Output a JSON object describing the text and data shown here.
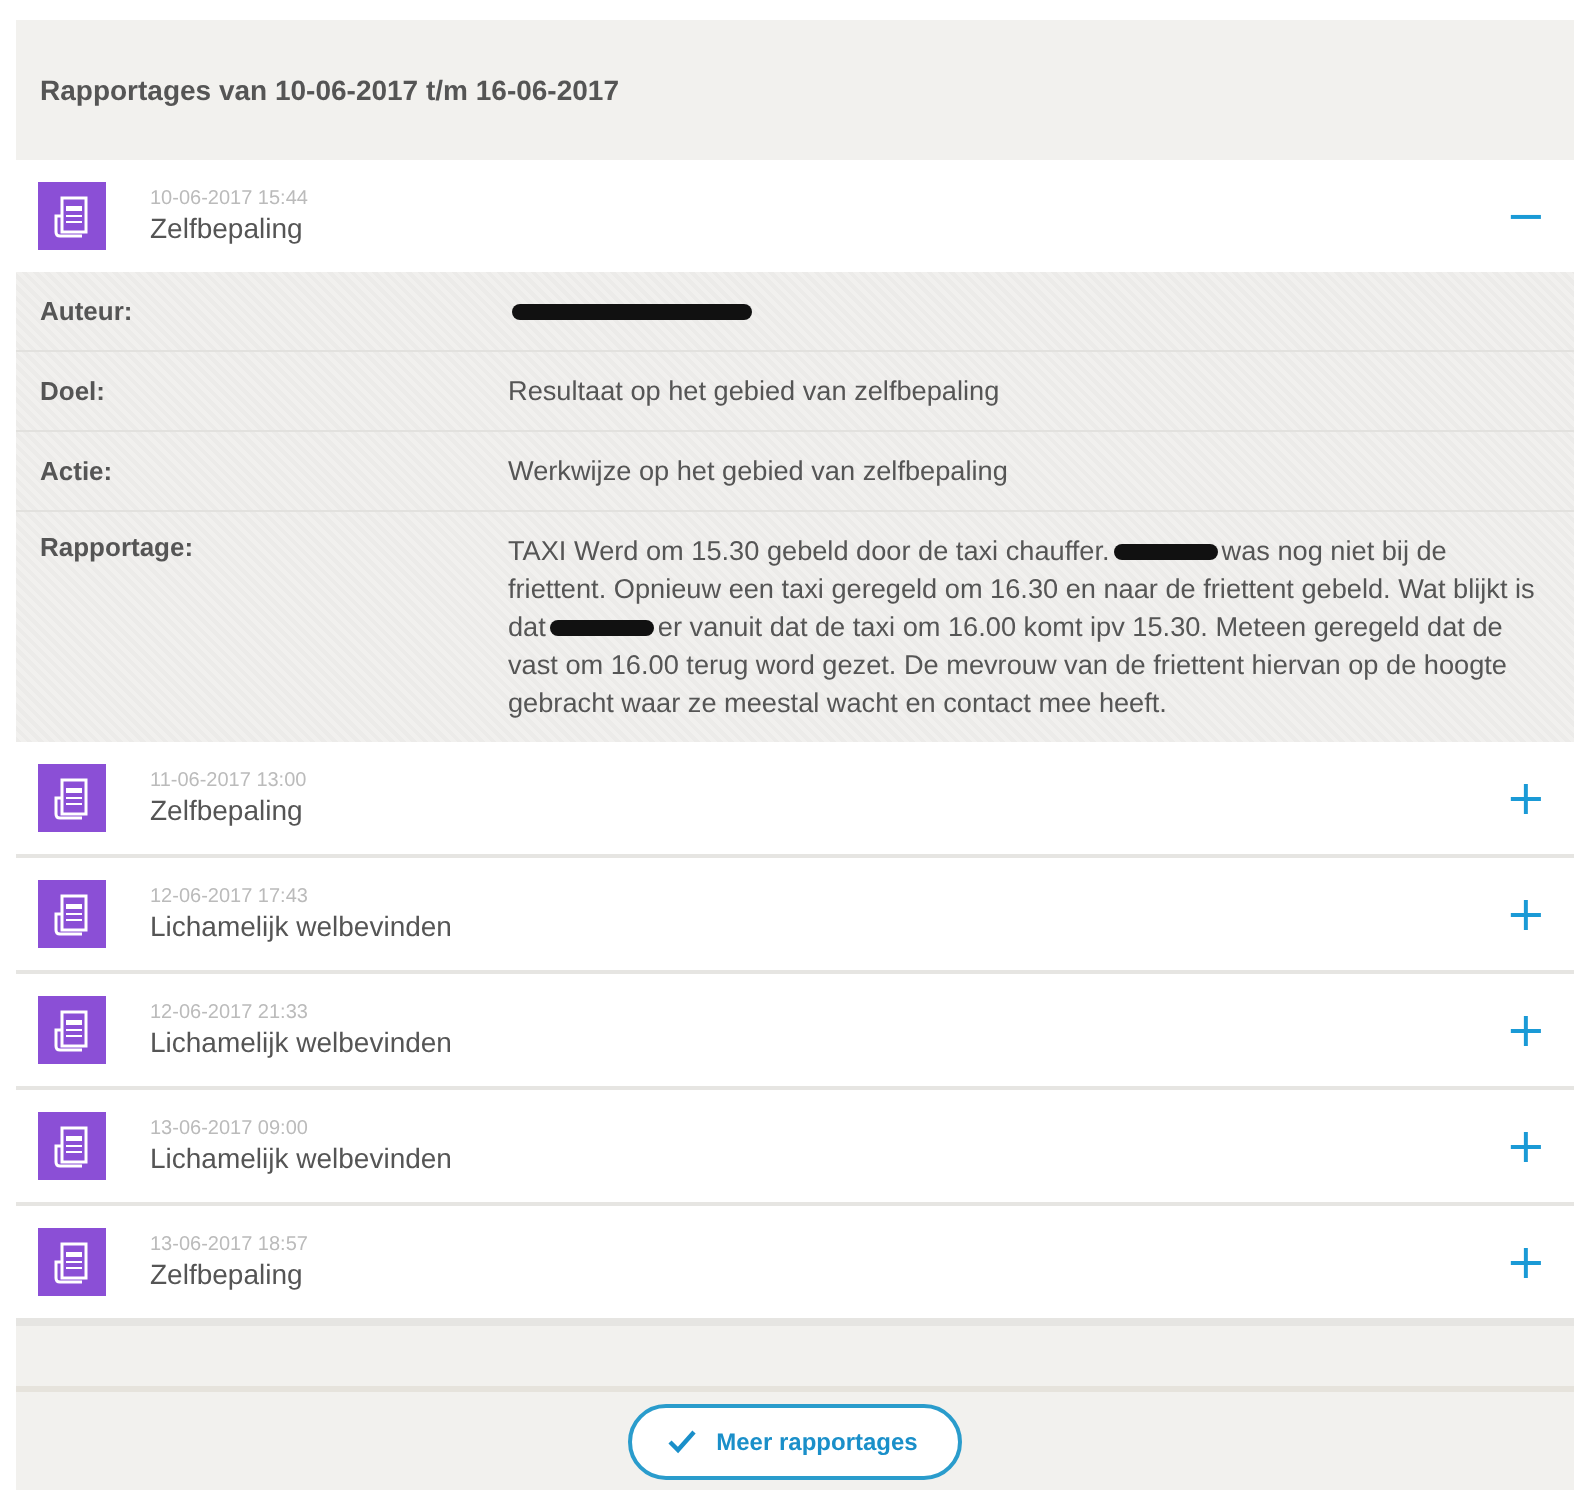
{
  "header": {
    "title": "Rapportages van 10-06-2017 t/m 16-06-2017"
  },
  "reports": [
    {
      "datetime": "10-06-2017 15:44",
      "category": "Zelfbepaling",
      "expanded": true,
      "toggle": "−",
      "details": [
        {
          "label": "Auteur:",
          "redacted": true
        },
        {
          "label": "Doel:",
          "parts": [
            "Resultaat op het gebied van zelfbepaling"
          ]
        },
        {
          "label": "Actie:",
          "parts": [
            "Werkwijze op het gebied van zelfbepaling"
          ]
        },
        {
          "label": "Rapportage:",
          "parts": [
            "TAXI Werd om 15.30 gebeld door de taxi chauffer.",
            "was nog niet bij de friettent. Opnieuw een taxi geregeld om 16.30 en naar de friettent gebeld. Wat blijkt is dat",
            "er vanuit dat de taxi om 16.00 komt ipv 15.30. Meteen geregeld dat de vast om 16.00 terug word gezet. De mevrouw van de friettent hiervan op de hoogte gebracht waar ze meestal wacht en contact mee heeft."
          ]
        }
      ]
    },
    {
      "datetime": "11-06-2017 13:00",
      "category": "Zelfbepaling",
      "expanded": false,
      "toggle": "+"
    },
    {
      "datetime": "12-06-2017 17:43",
      "category": "Lichamelijk welbevinden",
      "expanded": false,
      "toggle": "+"
    },
    {
      "datetime": "12-06-2017 21:33",
      "category": "Lichamelijk welbevinden",
      "expanded": false,
      "toggle": "+"
    },
    {
      "datetime": "13-06-2017 09:00",
      "category": "Lichamelijk welbevinden",
      "expanded": false,
      "toggle": "+"
    },
    {
      "datetime": "13-06-2017 18:57",
      "category": "Zelfbepaling",
      "expanded": false,
      "toggle": "+"
    }
  ],
  "more_button": {
    "label": "Meer rapportages"
  }
}
